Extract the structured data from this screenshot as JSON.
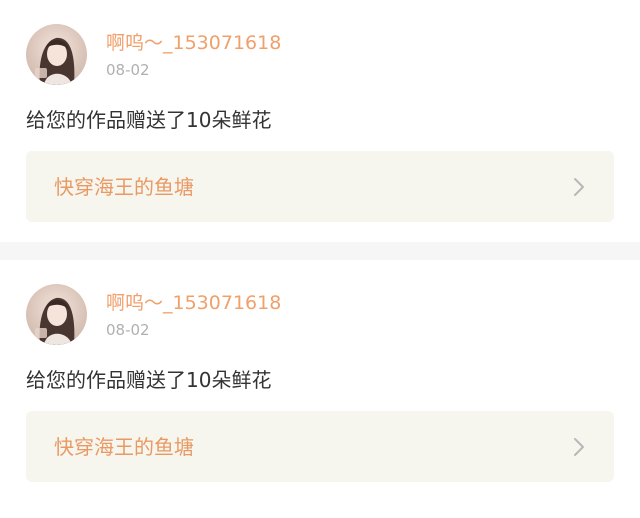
{
  "notifications": [
    {
      "username": "啊呜～_153071618",
      "date": "08-02",
      "message": "给您的作品赠送了10朵鲜花",
      "work_title": "快穿海王的鱼塘",
      "avatar_icon": "user-avatar-photo",
      "arrow_icon": "chevron-right-icon"
    },
    {
      "username": "啊呜～_153071618",
      "date": "08-02",
      "message": "给您的作品赠送了10朵鲜花",
      "work_title": "快穿海王的鱼塘",
      "avatar_icon": "user-avatar-photo",
      "arrow_icon": "chevron-right-icon"
    }
  ],
  "colors": {
    "accent": "#f0a06b",
    "work_title": "#e99a64",
    "card_link_bg": "#f6f5ee",
    "page_bg": "#f6f6f6",
    "date": "#b0b0b0",
    "message": "#333333"
  }
}
